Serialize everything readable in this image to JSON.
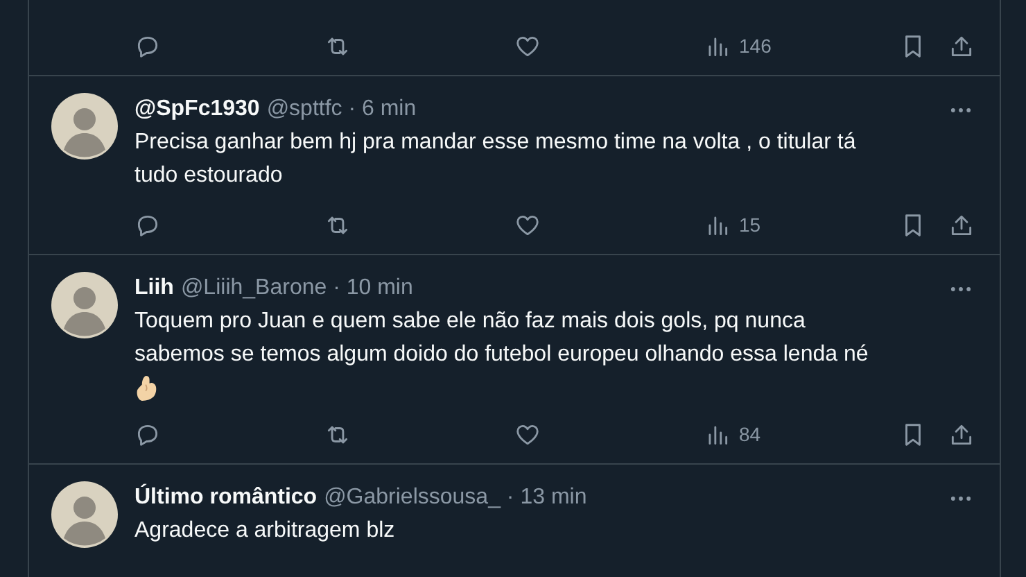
{
  "top_actions": {
    "views": "146"
  },
  "tweets": [
    {
      "name": "@SpFc1930",
      "handle": "@spttfc",
      "sep": "·",
      "time": "6 min",
      "lines": [
        "Precisa ganhar bem hj pra mandar esse mesmo time na volta , o titular tá",
        "tudo estourado"
      ],
      "gesture_icon": false,
      "views": "15"
    },
    {
      "name": "Liih",
      "handle": "@Liiih_Barone",
      "sep": "·",
      "time": "10 min",
      "lines": [
        "Toquem pro Juan e quem sabe ele não faz mais dois gols, pq nunca",
        "sabemos se temos algum doido do futebol europeu olhando essa lenda né"
      ],
      "gesture_icon": true,
      "views": "84"
    },
    {
      "name": "Último romântico",
      "handle": "@Gabrielssousa_",
      "sep": "·",
      "time": "13 min",
      "lines": [
        "Agradece a arbitragem blz"
      ],
      "gesture_icon": false
    }
  ]
}
